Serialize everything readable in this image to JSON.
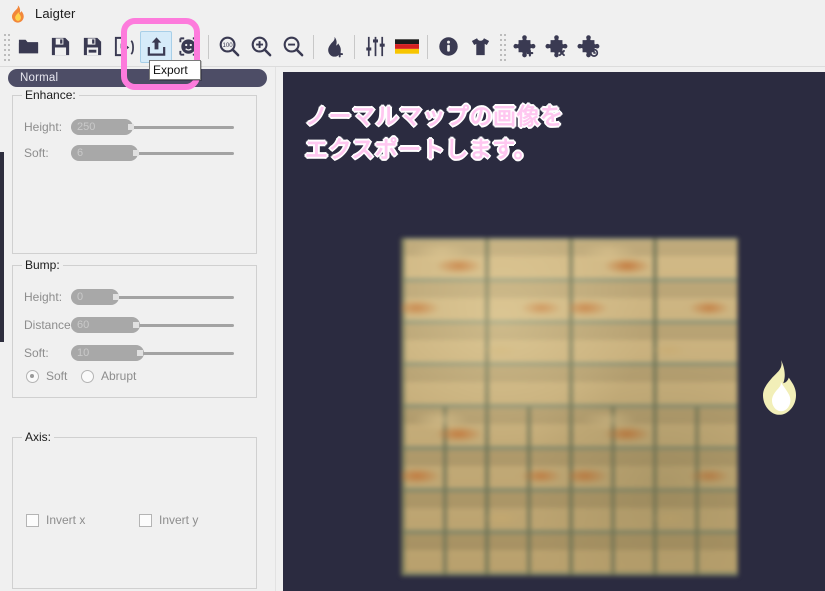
{
  "window": {
    "title": "Laigter",
    "app_icon": "flame-icon"
  },
  "toolbar": {
    "items": [
      {
        "name": "open-folder-icon",
        "tooltip": "Open"
      },
      {
        "name": "save-icon",
        "tooltip": "Save"
      },
      {
        "name": "save-as-icon",
        "tooltip": "Save As"
      },
      {
        "name": "load-project-icon",
        "tooltip": "Load"
      },
      {
        "name": "export-icon",
        "tooltip": "Export"
      },
      {
        "name": "export-selected-icon",
        "tooltip": "Export Selected"
      },
      {
        "name": "zoom-100-icon",
        "tooltip": "Zoom 100%"
      },
      {
        "name": "zoom-in-icon",
        "tooltip": "Zoom In"
      },
      {
        "name": "zoom-out-icon",
        "tooltip": "Zoom Out"
      },
      {
        "name": "add-light-icon",
        "tooltip": "Add Light"
      },
      {
        "name": "sliders-icon",
        "tooltip": "Settings"
      },
      {
        "name": "german-flag-icon",
        "tooltip": "Language"
      },
      {
        "name": "info-icon",
        "tooltip": "About"
      },
      {
        "name": "shirt-icon",
        "tooltip": "Merch"
      },
      {
        "name": "add-plugin-icon",
        "tooltip": "Add Plugin"
      },
      {
        "name": "remove-plugin-icon",
        "tooltip": "Remove Plugin"
      },
      {
        "name": "config-plugin-icon",
        "tooltip": "Configure Plugin"
      }
    ],
    "active_tooltip": "Export",
    "highlight_color": "#fd7bdc",
    "hover_bg": "#d6ebf9"
  },
  "left_panel": {
    "tab": {
      "label": "Normal"
    },
    "enhance": {
      "legend": "Enhance:",
      "sliders": [
        {
          "label": "Height:",
          "value": "250",
          "fill_pct": 36,
          "handle_pct": 33
        },
        {
          "label": "Soft:",
          "value": "6",
          "fill_pct": 39,
          "handle_pct": 36
        }
      ]
    },
    "bump": {
      "legend": "Bump:",
      "sliders": [
        {
          "label": "Height:",
          "value": "0",
          "fill_pct": 28,
          "handle_pct": 24
        },
        {
          "label": "Distance:",
          "value": "60",
          "fill_pct": 40,
          "handle_pct": 36
        },
        {
          "label": "Soft:",
          "value": "10",
          "fill_pct": 42,
          "handle_pct": 38
        }
      ],
      "radios": [
        {
          "label": "Soft",
          "selected": true
        },
        {
          "label": "Abrupt",
          "selected": false
        }
      ]
    },
    "axis": {
      "legend": "Axis:",
      "checkboxes": [
        {
          "label": "Invert x",
          "checked": false
        },
        {
          "label": "Invert y",
          "checked": false
        }
      ]
    }
  },
  "preview": {
    "background_color": "#2b2b40",
    "overlay_text": "ノーマルマップの画像を\nエクスポートします。",
    "overlay_text_color": "#ffc7f0",
    "overlay_outline_color": "#ffffff",
    "texture_name": "brick-wall-texture",
    "watermark": "flame-logo-icon"
  }
}
